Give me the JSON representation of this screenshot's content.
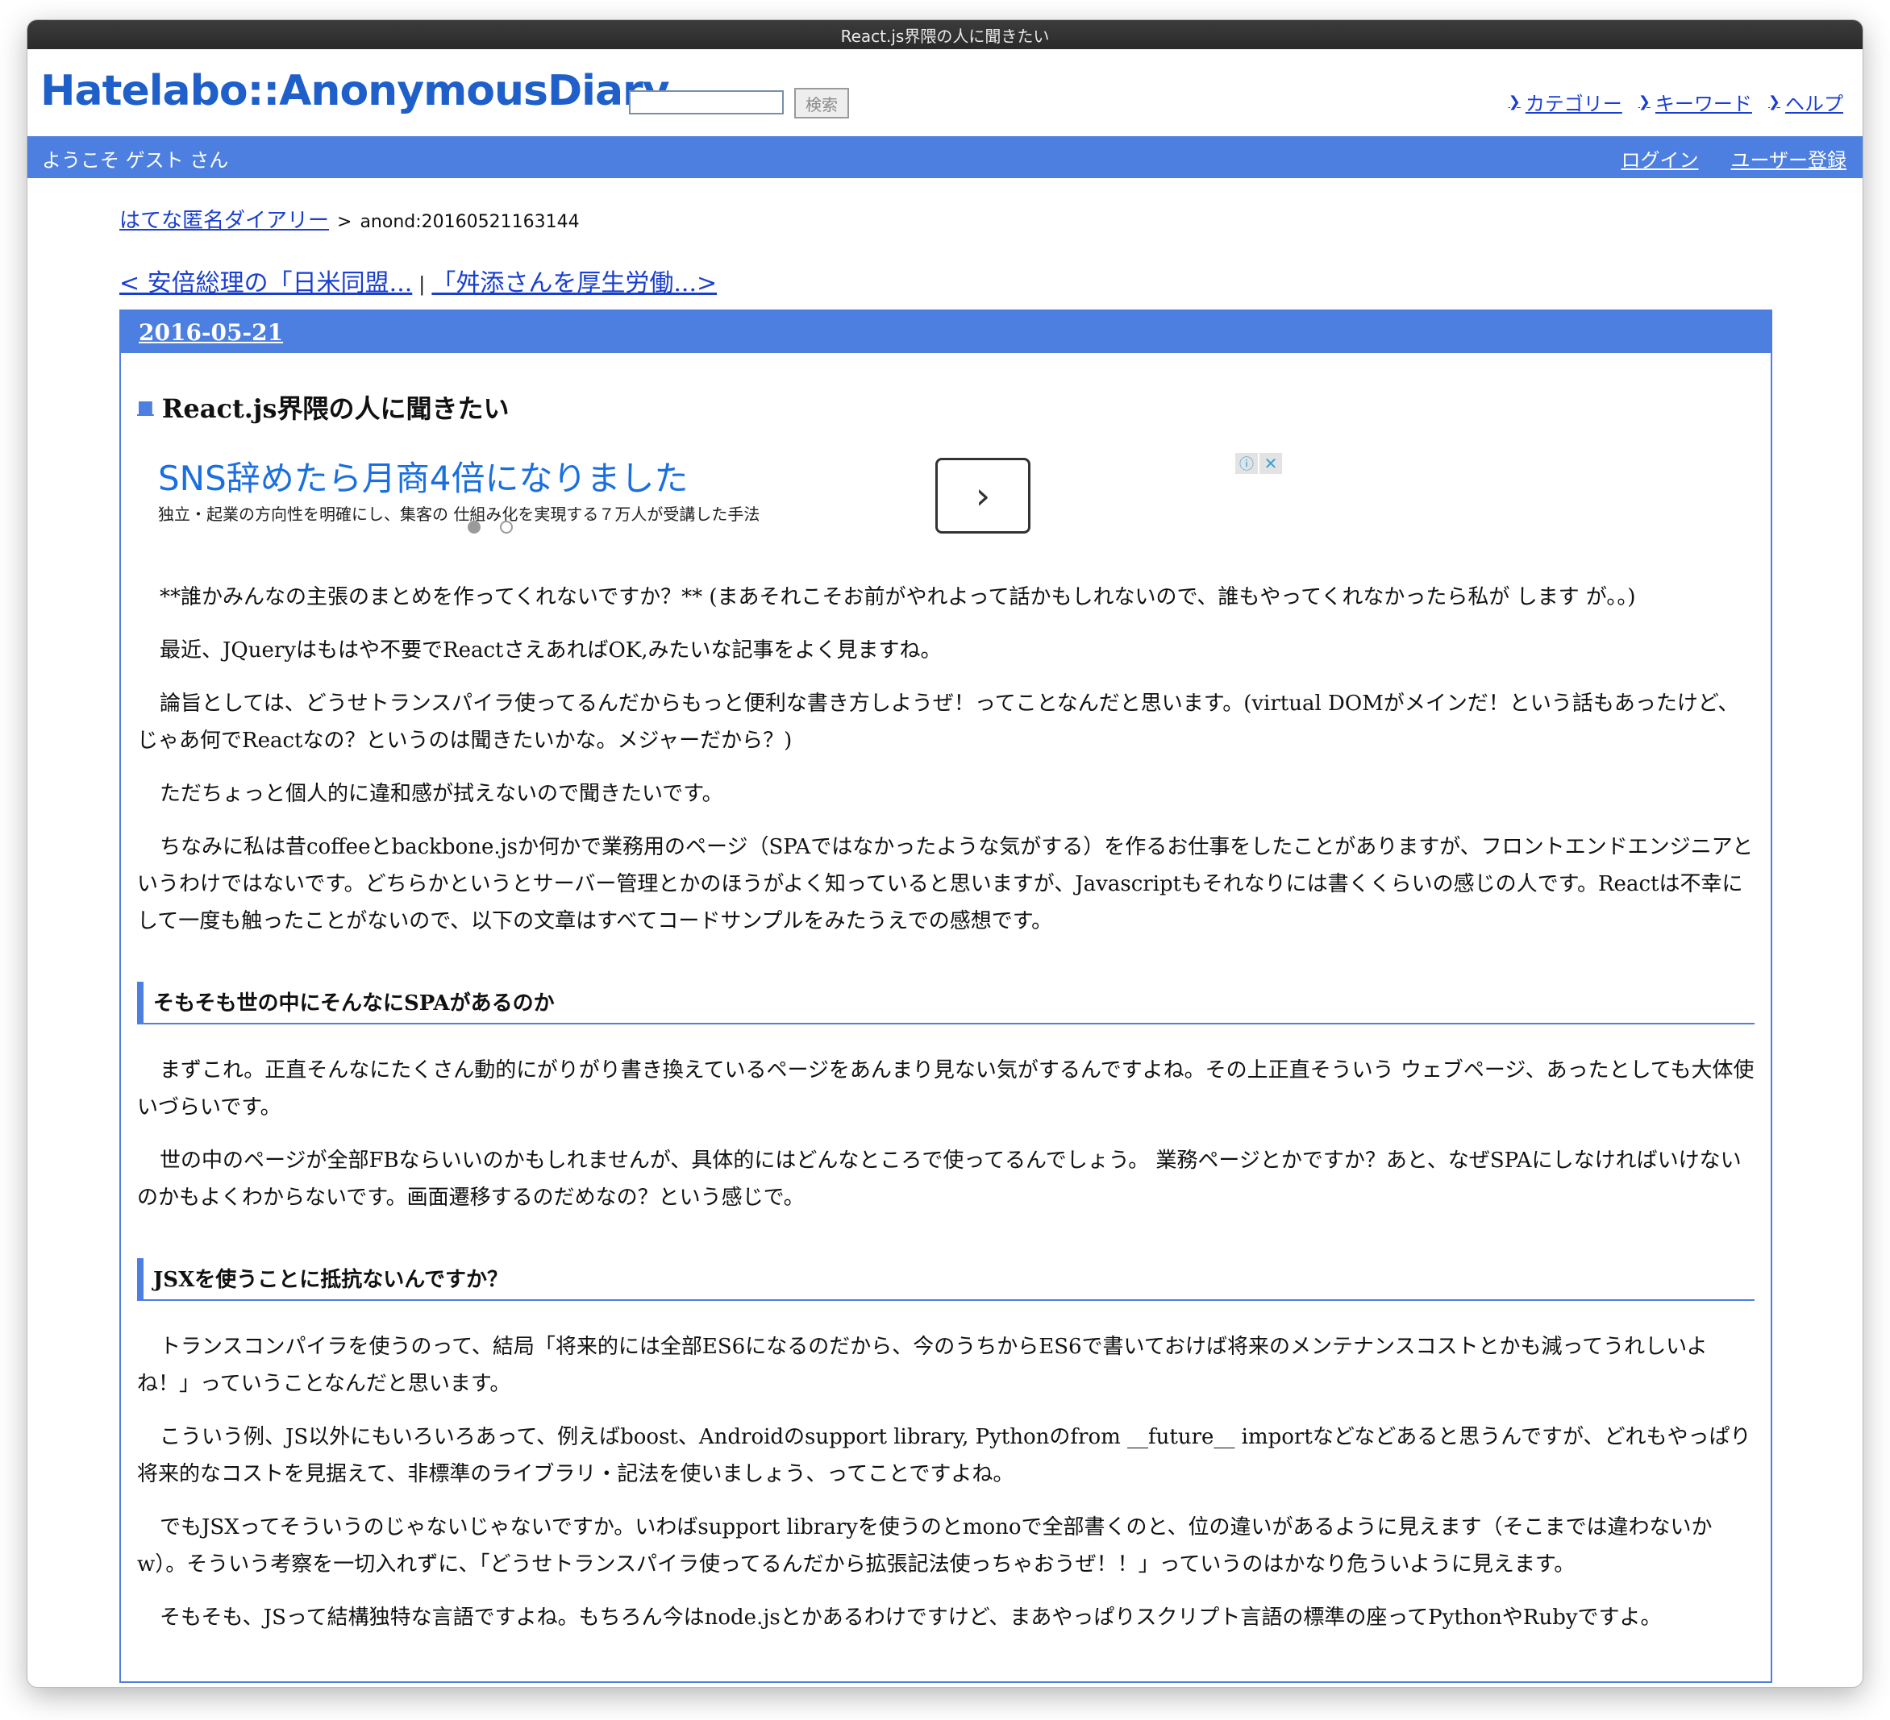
{
  "window": {
    "title": "React.js界隈の人に聞きたい"
  },
  "header": {
    "logo": "Hatelabo::AnonymousDiary",
    "search_placeholder": "",
    "search_button": "検索",
    "links": [
      "カテゴリー",
      "キーワード",
      "ヘルプ"
    ]
  },
  "bluebar": {
    "welcome": "ようこそ ゲスト さん",
    "login": "ログイン",
    "register": "ユーザー登録"
  },
  "breadcrumb": {
    "home": "はてな匿名ダイアリー",
    "sep": ">",
    "id": "anond:20160521163144"
  },
  "nav": {
    "prev": "< 安倍総理の「日米同盟...",
    "sep": "|",
    "next": "「舛添さんを厚生労働...>"
  },
  "entry": {
    "date": "2016-05-21",
    "title_marker": "■",
    "title": "React.js界隈の人に聞きたい",
    "ad": {
      "headline": "SNS辞めたら月商4倍になりました",
      "subline": "独立・起業の方向性を明確にし、集客の 仕組み化を実現する７万人が受講した手法",
      "arrow": "›",
      "info": "ⓘ",
      "close": "✕"
    },
    "paragraphs_1": [
      "**誰かみんなの主張のまとめを作ってくれないですか？** (まあそれこそお前がやれよって話かもしれないので、誰もやってくれなかったら私が します が。。)",
      "最近、JQueryはもはや不要でReactさえあればOK,みたいな記事をよく見ますね。",
      "論旨としては、どうせトランスパイラ使ってるんだからもっと便利な書き方しようぜ！ってことなんだと思います。(virtual DOMがメインだ！という話もあったけど、じゃあ何でReactなの？というのは聞きたいかな。メジャーだから？)",
      "ただちょっと個人的に違和感が拭えないので聞きたいです。",
      "ちなみに私は昔coffeeとbackbone.jsか何かで業務用のページ（SPAではなかったような気がする）を作るお仕事をしたことがありますが、フロントエンドエンジニアというわけではないです。どちらかというとサーバー管理とかのほうがよく知っていると思いますが、Javascriptもそれなりには書くくらいの感じの人です。Reactは不幸にして一度も触ったことがないので、以下の文章はすべてコードサンプルをみたうえでの感想です。"
    ],
    "section_1": "そもそも世の中にそんなにSPAがあるのか",
    "paragraphs_2": [
      "まずこれ。正直そんなにたくさん動的にがりがり書き換えているページをあんまり見ない気がするんですよね。その上正直そういう ウェブページ、あったとしても大体使いづらいです。",
      "世の中のページが全部FBならいいのかもしれませんが、具体的にはどんなところで使ってるんでしょう。 業務ページとかですか？あと、なぜSPAにしなければいけないのかもよくわからないです。画面遷移するのだめなの？という感じで。"
    ],
    "section_2": "JSXを使うことに抵抗ないんですか？",
    "paragraphs_3": [
      "トランスコンパイラを使うのって、結局「将来的には全部ES6になるのだから、今のうちからES6で書いておけば将来のメンテナンスコストとかも減ってうれしいよね！」っていうことなんだと思います。",
      "こういう例、JS以外にもいろいろあって、例えばboost、Androidのsupport library, Pythonのfrom __future__ importなどなどあると思うんですが、どれもやっぱり将来的なコストを見据えて、非標準のライブラリ・記法を使いましょう、ってことですよね。",
      "でもJSXってそういうのじゃないじゃないですか。いわばsupport libraryを使うのとmonoで全部書くのと、位の違いがあるように見えます（そこまでは違わないかw）。そういう考察を一切入れずに、「どうせトランスパイラ使ってるんだから拡張記法使っちゃおうぜ！！」っていうのはかなり危ういように見えます。",
      "そもそも、JSって結構独特な言語ですよね。もちろん今はnode.jsとかあるわけですけど、まあやっぱりスクリプト言語の標準の座ってPythonやRubyですよ。"
    ]
  }
}
